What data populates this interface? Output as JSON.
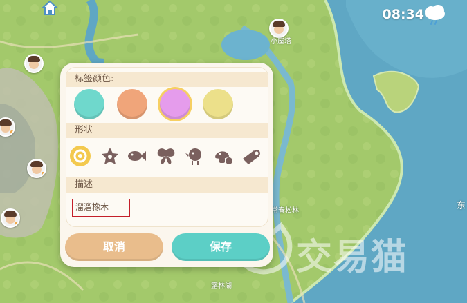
{
  "hud": {
    "time": "08:34",
    "weather_icon": "cloud-rain-icon",
    "home_icon": "home-icon"
  },
  "map": {
    "labels": [
      "小屋塔",
      "常春松林",
      "露林湖",
      "东"
    ]
  },
  "watermark": {
    "text": "交易猫"
  },
  "dialog": {
    "color_label": "标签颜色:",
    "shape_label": "形状",
    "desc_label": "描述",
    "description_value": "溜溜橡木",
    "colors": [
      {
        "name": "teal",
        "hex": "#6fd8cc",
        "selected": false
      },
      {
        "name": "orange",
        "hex": "#f0a57a",
        "selected": false
      },
      {
        "name": "pink",
        "hex": "#e59cec",
        "selected": true
      },
      {
        "name": "yellow",
        "hex": "#ece08a",
        "selected": false
      }
    ],
    "shapes": [
      "location-target-icon",
      "flower-icon",
      "fish-icon",
      "butterfly-icon",
      "bird-icon",
      "mushroom-icon",
      "log-icon"
    ],
    "selected_shape": "location-target-icon",
    "cancel_label": "取消",
    "save_label": "保存"
  }
}
